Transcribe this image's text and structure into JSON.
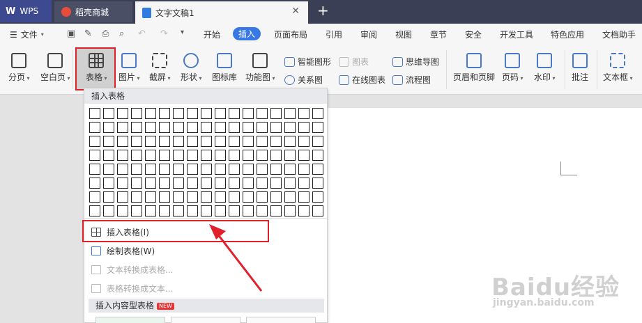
{
  "tabs": {
    "wps": "WPS",
    "store": "稻壳商城",
    "doc": "文字文稿1",
    "close": "✕",
    "add": "+"
  },
  "menubar": {
    "file": "文件",
    "tabs": [
      "开始",
      "插入",
      "页面布局",
      "引用",
      "审阅",
      "视图",
      "章节",
      "安全",
      "开发工具",
      "特色应用",
      "文档助手"
    ],
    "active_tab": "插入"
  },
  "ribbon": {
    "page_break": "分页",
    "blank_page": "空白页",
    "table": "表格",
    "picture": "图片",
    "screenshot": "截屏",
    "shape": "形状",
    "icon_lib": "图标库",
    "func_chart": "功能图",
    "smart_graphic": "智能图形",
    "chart": "图表",
    "relation_chart": "关系图",
    "online_chart": "在线图表",
    "mind_map": "思维导图",
    "flow_chart": "流程图",
    "header_footer": "页眉和页脚",
    "page_number": "页码",
    "watermark": "水印",
    "comment": "批注",
    "text_box": "文本框"
  },
  "dropdown": {
    "header": "插入表格",
    "items": {
      "insert_table": "插入表格(I)",
      "draw_table": "绘制表格(W)",
      "text_to_table": "文本转换成表格...",
      "table_to_text": "表格转换成文本..."
    },
    "content_tables": "插入内容型表格",
    "new_badge": "NEW"
  },
  "watermark": {
    "line1": "Baidu经验",
    "line2": "jingyan.baidu.com"
  },
  "colors": {
    "accent": "#3878e4",
    "highlight": "#e0202a",
    "tabbar": "#3a3f55"
  }
}
